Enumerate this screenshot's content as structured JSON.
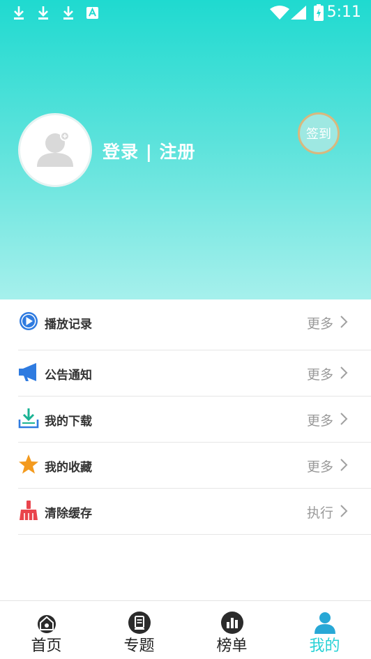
{
  "status_bar": {
    "time": "5:11",
    "left_icons": [
      "download-icon",
      "download-icon",
      "download-icon",
      "a-notification-icon"
    ],
    "right_icons": [
      "wifi-icon",
      "signal-icon",
      "battery-icon"
    ]
  },
  "profile": {
    "login_label": "登录 | 注册",
    "signin_label": "签到"
  },
  "menu": {
    "items": [
      {
        "icon": "play-circle-icon",
        "label": "播放记录",
        "action": "更多"
      },
      {
        "icon": "megaphone-icon",
        "label": "公告通知",
        "action": "更多"
      },
      {
        "icon": "download-tray-icon",
        "label": "我的下载",
        "action": "更多"
      },
      {
        "icon": "star-icon",
        "label": "我的收藏",
        "action": "更多"
      },
      {
        "icon": "broom-icon",
        "label": "清除缓存",
        "action": "执行"
      }
    ]
  },
  "bottom_nav": {
    "items": [
      {
        "icon": "home-icon",
        "label": "首页"
      },
      {
        "icon": "topic-icon",
        "label": "专题"
      },
      {
        "icon": "chart-icon",
        "label": "榜单"
      },
      {
        "icon": "user-icon",
        "label": "我的"
      }
    ],
    "active_index": 3
  },
  "colors": {
    "accent": "#28d2d6",
    "header_top": "#1fdad0",
    "header_bottom": "#a6f0ec",
    "signin_ring": "#d9b87e"
  }
}
